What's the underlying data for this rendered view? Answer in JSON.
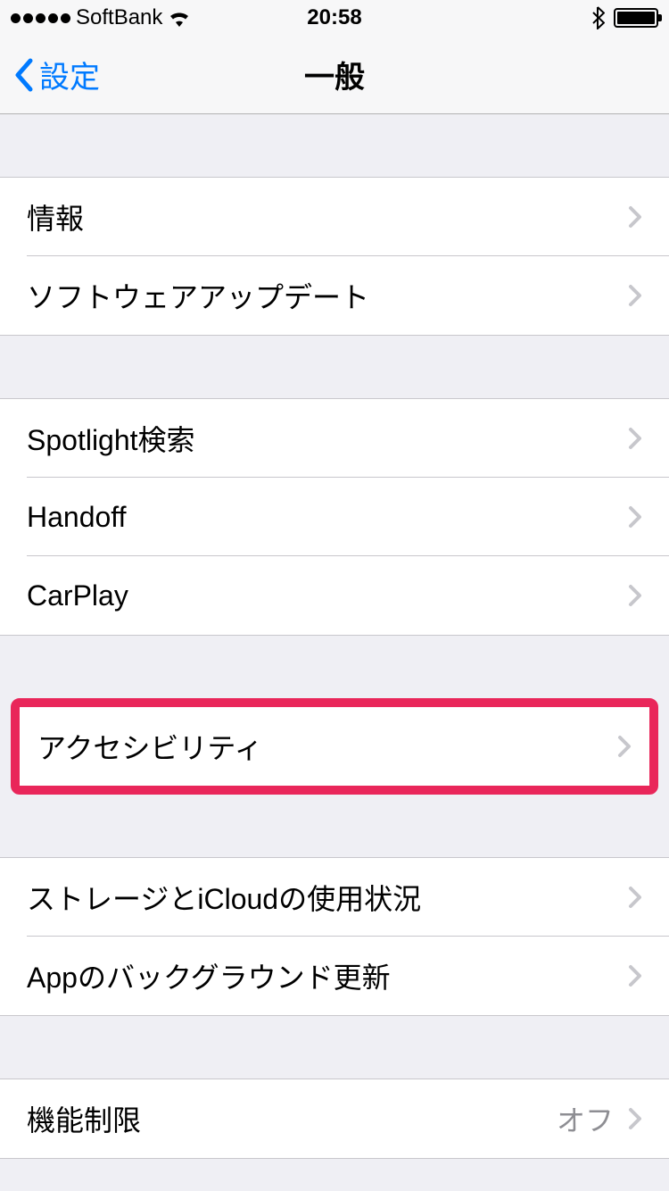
{
  "statusBar": {
    "carrier": "SoftBank",
    "time": "20:58"
  },
  "nav": {
    "back": "設定",
    "title": "一般"
  },
  "groups": {
    "g1": {
      "about": "情報",
      "softwareUpdate": "ソフトウェアアップデート"
    },
    "g2": {
      "spotlight": "Spotlight検索",
      "handoff": "Handoff",
      "carplay": "CarPlay"
    },
    "g3": {
      "accessibility": "アクセシビリティ"
    },
    "g4": {
      "storage": "ストレージとiCloudの使用状況",
      "backgroundRefresh": "Appのバックグラウンド更新"
    },
    "g5": {
      "restrictions": "機能制限",
      "restrictionsValue": "オフ"
    }
  }
}
